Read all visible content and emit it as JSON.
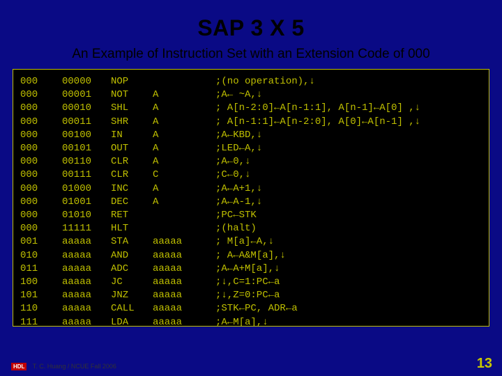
{
  "title": "SAP 3 X 5",
  "subtitle": "An Example of Instruction Set with an Extension Code of 000",
  "footer": {
    "badge": "HDL",
    "credit": "T. C. Huang / NCUE  Fall 2006"
  },
  "pagenum": "13",
  "rows": [
    {
      "op": "000",
      "code": "00000",
      "mn": "NOP",
      "arg": "",
      "cm": ";(no operation),↓"
    },
    {
      "op": "000",
      "code": "00001",
      "mn": "NOT",
      "arg": "A",
      "cm": ";A← ~A,↓"
    },
    {
      "op": "000",
      "code": "00010",
      "mn": "SHL",
      "arg": "A",
      "cm": "; A[n-2:0]←A[n-1:1], A[n-1]←A[0] ,↓"
    },
    {
      "op": "000",
      "code": "00011",
      "mn": "SHR",
      "arg": "A",
      "cm": "; A[n-1:1]←A[n-2:0], A[0]←A[n-1] ,↓"
    },
    {
      "op": "000",
      "code": "00100",
      "mn": "IN",
      "arg": "A",
      "cm": ";A←KBD,↓"
    },
    {
      "op": "000",
      "code": "00101",
      "mn": "OUT",
      "arg": "A",
      "cm": ";LED←A,↓"
    },
    {
      "op": "000",
      "code": "00110",
      "mn": "CLR",
      "arg": "A",
      "cm": ";A←0,↓"
    },
    {
      "op": "000",
      "code": "00111",
      "mn": "CLR",
      "arg": "C",
      "cm": ";C←0,↓"
    },
    {
      "op": "000",
      "code": "01000",
      "mn": "INC",
      "arg": "A",
      "cm": ";A←A+1,↓"
    },
    {
      "op": "000",
      "code": "01001",
      "mn": "DEC",
      "arg": "A",
      "cm": ";A←A-1,↓"
    },
    {
      "op": "000",
      "code": "01010",
      "mn": "RET",
      "arg": "",
      "cm": ";PC←STK"
    },
    {
      "op": "000",
      "code": "11111",
      "mn": "HLT",
      "arg": "",
      "cm": ";(halt)"
    },
    {
      "op": "001",
      "code": "aaaaa",
      "mn": "STA",
      "arg": "aaaaa",
      "cm": "; M[a]←A,↓"
    },
    {
      "op": "010",
      "code": "aaaaa",
      "mn": "AND",
      "arg": "aaaaa",
      "cm": "; A←A&M[a],↓"
    },
    {
      "op": "011",
      "code": "aaaaa",
      "mn": "ADC",
      "arg": "aaaaa",
      "cm": ";A←A+M[a],↓"
    },
    {
      "op": "100",
      "code": "aaaaa",
      "mn": "JC",
      "arg": "aaaaa",
      "cm": ";↓,C=1:PC←a"
    },
    {
      "op": "101",
      "code": "aaaaa",
      "mn": "JNZ",
      "arg": "aaaaa",
      "cm": ";↓,Z=0:PC←a"
    },
    {
      "op": "110",
      "code": "aaaaa",
      "mn": "CALL",
      "arg": "aaaaa",
      "cm": ";STK←PC, ADR←a"
    },
    {
      "op": "111",
      "code": "aaaaa",
      "mn": "LDA",
      "arg": "aaaaa",
      "cm": ";A←M[a],↓"
    }
  ]
}
